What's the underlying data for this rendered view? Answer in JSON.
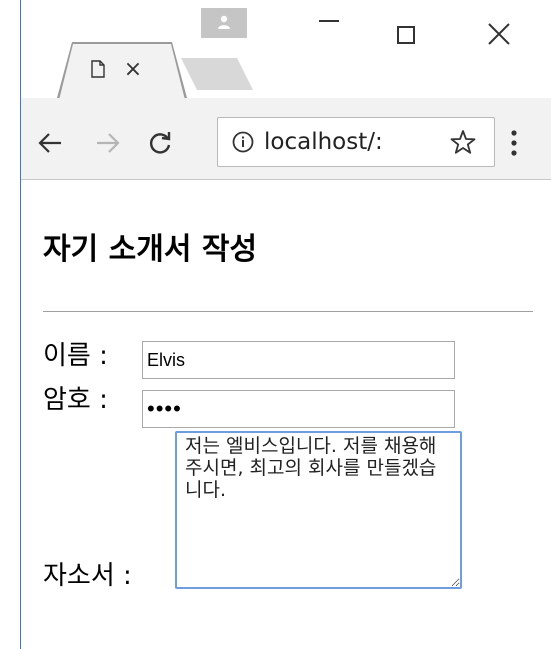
{
  "browser": {
    "tab": {
      "close_glyph": "×"
    },
    "address_bar": {
      "url": "localhost/:"
    },
    "colors": {
      "window_border": "#3c78c8",
      "focus_ring": "#6f9ee0"
    },
    "icons": {
      "page": "page-icon",
      "profile": "profile-icon",
      "minimize": "minimize-icon",
      "maximize": "maximize-icon",
      "close": "close-icon",
      "back": "arrow-left-icon",
      "forward": "arrow-right-icon",
      "reload": "reload-icon",
      "info": "info-icon",
      "star": "star-icon",
      "menu": "kebab-menu-icon"
    }
  },
  "page": {
    "title": "자기 소개서 작성",
    "form": {
      "name_label": "이름 :",
      "name_value": "Elvis",
      "password_label": "암호 :",
      "password_value": "aaaa",
      "intro_label": "자소서 :",
      "intro_value": "저는 엘비스입니다. 저를 채용해주시면, 최고의 회사를 만들겠습니다."
    }
  }
}
